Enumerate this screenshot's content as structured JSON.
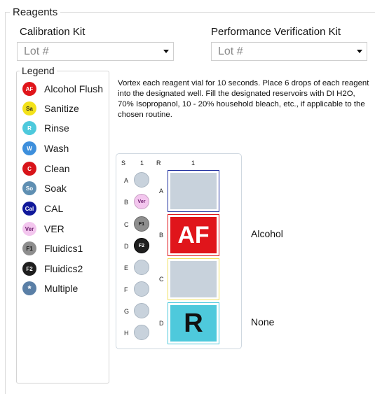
{
  "group_title": "Reagents",
  "calibration_kit": {
    "label": "Calibration Kit",
    "placeholder": "Lot #"
  },
  "performance_kit": {
    "label": "Performance Verification Kit",
    "placeholder": "Lot #"
  },
  "legend": {
    "title": "Legend",
    "items": [
      {
        "abbr": "AF",
        "label": "Alcohol Flush",
        "bg": "#e0151b",
        "fg": "#ffffff"
      },
      {
        "abbr": "Sa",
        "label": "Sanitize",
        "bg": "#f3e21a",
        "fg": "#222222"
      },
      {
        "abbr": "R",
        "label": "Rinse",
        "bg": "#4ec9dc",
        "fg": "#ffffff"
      },
      {
        "abbr": "W",
        "label": "Wash",
        "bg": "#3d8fdc",
        "fg": "#ffffff"
      },
      {
        "abbr": "C",
        "label": "Clean",
        "bg": "#d8141a",
        "fg": "#ffffff"
      },
      {
        "abbr": "So",
        "label": "Soak",
        "bg": "#5f8fb2",
        "fg": "#ffffff"
      },
      {
        "abbr": "Cal",
        "label": "CAL",
        "bg": "#10189a",
        "fg": "#ffffff"
      },
      {
        "abbr": "Ver",
        "label": "VER",
        "bg": "#f3c6ee",
        "fg": "#6a1b6a"
      },
      {
        "abbr": "F1",
        "label": "Fluidics1",
        "bg": "#8e8e8e",
        "fg": "#111111"
      },
      {
        "abbr": "F2",
        "label": "Fluidics2",
        "bg": "#1e1e1e",
        "fg": "#ffffff"
      },
      {
        "abbr": "*",
        "label": "Multiple",
        "bg": "#5a7fa6",
        "fg": "#ffffff"
      }
    ]
  },
  "instructions": "Vortex each reagent vial for 10 seconds. Place 6 drops of each reagent into the designated well. Fill the designated reservoirs with DI H2O, 70% Isopropanol, 10 - 20% household bleach, etc., if applicable to the chosen routine.",
  "plate": {
    "headers": {
      "s": "S",
      "col1": "1",
      "r": "R",
      "rcol": "1"
    },
    "wells": [
      {
        "row": "A",
        "content": ""
      },
      {
        "row": "B",
        "content": "Ver"
      },
      {
        "row": "C",
        "content": "F1"
      },
      {
        "row": "D",
        "content": "F2"
      },
      {
        "row": "E",
        "content": ""
      },
      {
        "row": "F",
        "content": ""
      },
      {
        "row": "G",
        "content": ""
      },
      {
        "row": "H",
        "content": ""
      }
    ],
    "reservoirs": [
      {
        "row": "A",
        "content": "",
        "label": "",
        "border": "#1f2f9e"
      },
      {
        "row": "B",
        "content": "AF",
        "label": "Alcohol",
        "border": "#e0151b"
      },
      {
        "row": "C",
        "content": "",
        "label": "",
        "border": "#f0e060"
      },
      {
        "row": "D",
        "content": "R",
        "label": "None",
        "border": "#4ec9dc"
      }
    ]
  }
}
